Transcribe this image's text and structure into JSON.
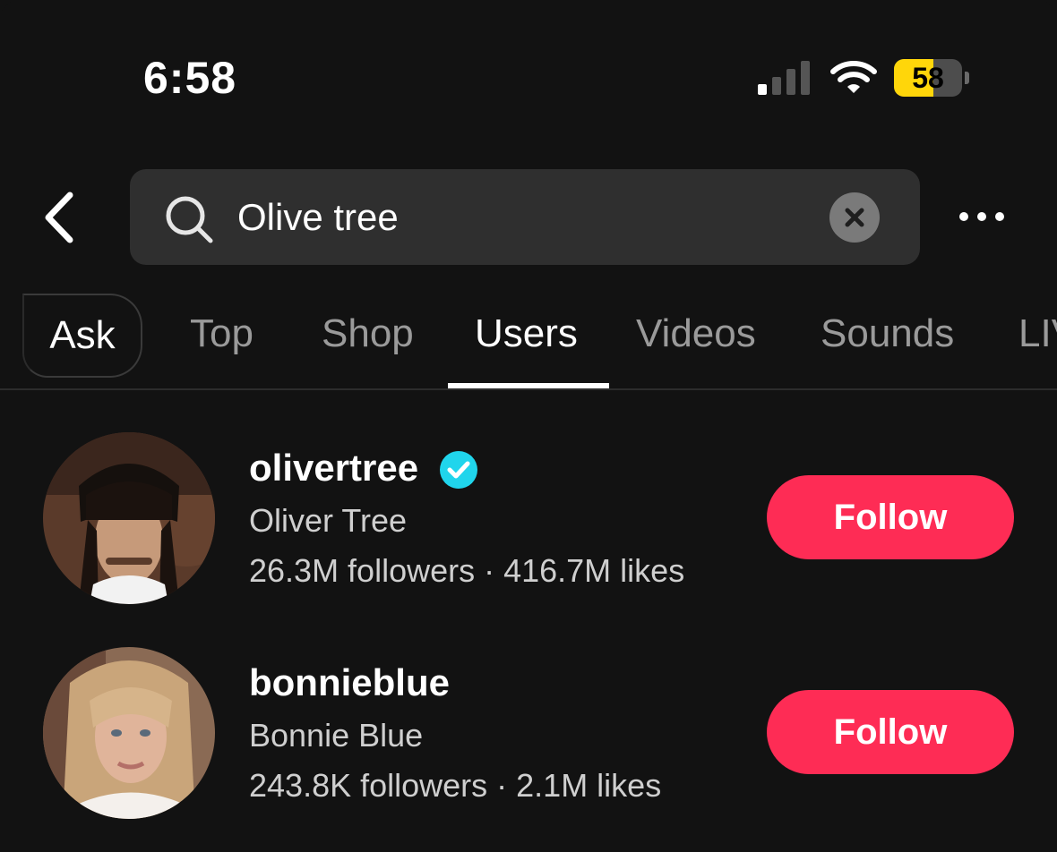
{
  "status_bar": {
    "time": "6:58",
    "battery": "58",
    "battery_level": 0.58,
    "battery_color": "#ffd60a",
    "icons": [
      "signal-icon",
      "wifi-icon",
      "battery-icon"
    ]
  },
  "search": {
    "query": "Olive tree",
    "icons": [
      "back-chevron-icon",
      "search-icon",
      "clear-icon",
      "more-icon"
    ]
  },
  "tabs": {
    "ask": "Ask",
    "top": "Top",
    "shop": "Shop",
    "users": "Users",
    "videos": "Videos",
    "sounds": "Sounds",
    "live": "LIV",
    "active": "Users"
  },
  "users": [
    {
      "username": "olivertree",
      "verified": true,
      "display_name": "Oliver Tree",
      "stats": "26.3M followers · 416.7M likes",
      "follow_label": "Follow"
    },
    {
      "username": "bonnieblue",
      "verified": false,
      "display_name": "Bonnie Blue",
      "stats": "243.8K followers · 2.1M likes",
      "follow_label": "Follow"
    }
  ],
  "colors": {
    "background": "#121212",
    "follow_button": "#fe2c55",
    "verified_badge": "#20d5ec"
  }
}
